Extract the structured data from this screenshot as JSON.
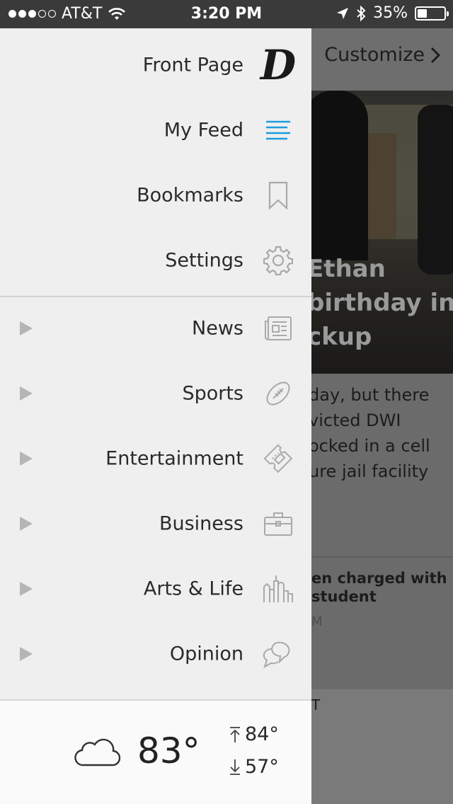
{
  "status_bar": {
    "carrier": "AT&T",
    "time": "3:20 PM",
    "battery": "35%",
    "battery_level": 0.35
  },
  "background": {
    "customize_label": "Customize",
    "headline_lines": [
      "Ethan",
      "birthday in",
      "ckup"
    ],
    "summary_lines": [
      "day, but there",
      "victed DWI",
      "ocked in a cell",
      "ure jail facility"
    ],
    "sub_headline_lines": [
      "en charged with",
      " student"
    ],
    "sub_meta": "M",
    "lower_label": "T"
  },
  "drawer": {
    "top_items": [
      {
        "label": "Front Page",
        "icon": "dmn-logo-icon"
      },
      {
        "label": "My Feed",
        "icon": "feed-lines-icon"
      },
      {
        "label": "Bookmarks",
        "icon": "bookmark-icon"
      },
      {
        "label": "Settings",
        "icon": "gear-icon"
      }
    ],
    "sections": [
      {
        "label": "News",
        "icon": "newspaper-icon"
      },
      {
        "label": "Sports",
        "icon": "football-icon"
      },
      {
        "label": "Entertainment",
        "icon": "ticket-icon"
      },
      {
        "label": "Business",
        "icon": "briefcase-icon"
      },
      {
        "label": "Arts & Life",
        "icon": "skyline-icon"
      },
      {
        "label": "Opinion",
        "icon": "speech-bubbles-icon"
      }
    ],
    "logo_letter": "D"
  },
  "weather": {
    "current": "83°",
    "high": "84°",
    "low": "57°",
    "icon": "cloud-icon"
  },
  "colors": {
    "accent": "#1a9ce0",
    "drawer_bg": "#efefef",
    "icon_gray": "#a9a9a9"
  }
}
